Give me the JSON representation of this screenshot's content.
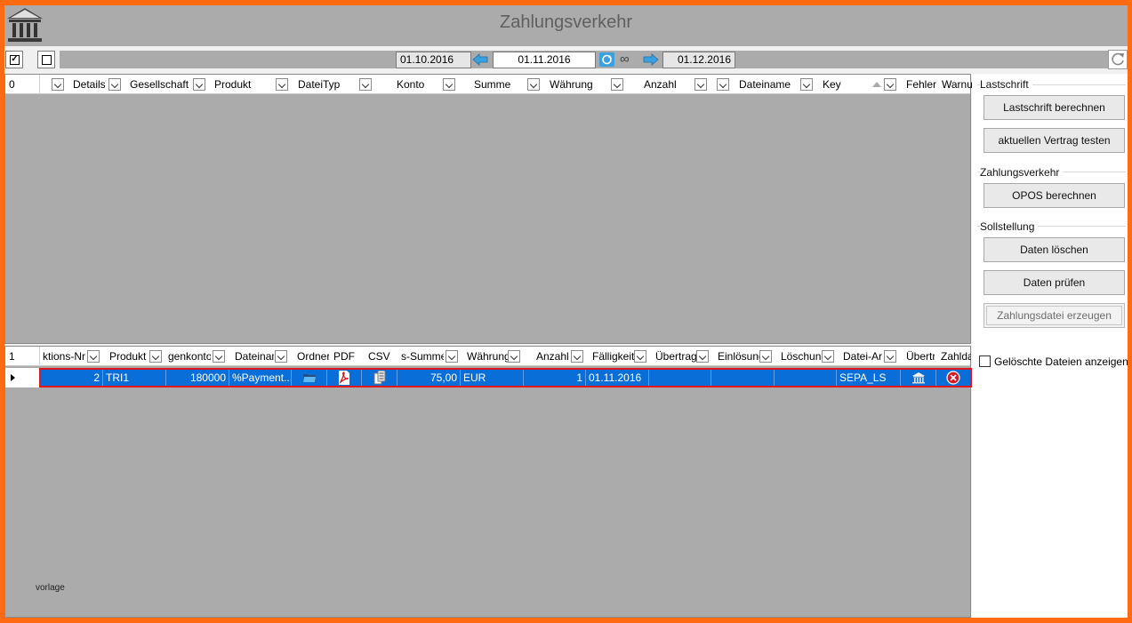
{
  "window": {
    "title": "Zahlungsverkehr"
  },
  "toolbar": {
    "select_all_checked": true,
    "select_none_checked": false,
    "date_prev": "01.10.2016",
    "date_current": "01.11.2016",
    "date_next": "01.12.2016",
    "link_symbol": "∞"
  },
  "grid_top": {
    "count": "0",
    "columns": [
      "Details",
      "Gesellschaft",
      "Produkt",
      "DateiTyp",
      "Konto",
      "Summe",
      "Währung",
      "Anzahl",
      "Dateiname",
      "Key",
      "Fehler",
      "Warnu"
    ]
  },
  "grid_bottom": {
    "count": "1",
    "columns": [
      "ktions-Nr",
      "Produkt",
      "genkonto",
      "Dateinam",
      "Ordner",
      "PDF",
      "CSV",
      "s-Summe",
      "Währung",
      "Anzahl",
      "Fälligkeit",
      "Übertragu",
      "Einlösung",
      "Löschung",
      "Datei-Art",
      "Übertr",
      "Zahlda"
    ],
    "row": {
      "nr": "2",
      "produkt": "TRI1",
      "konto": "180000",
      "dateiname": "%Payment...",
      "summe": "75,00",
      "waehrung": "EUR",
      "anzahl": "1",
      "faelligkeit": "01.11.2016",
      "uebertragung": "",
      "einloesung": "",
      "loeschung": "",
      "datei_art": "SEPA_LS"
    },
    "footnote": "vorlage"
  },
  "panel": {
    "lastschrift": {
      "label": "Lastschrift",
      "btn_berechnen": "Lastschrift berechnen",
      "btn_testen": "aktuellen Vertrag testen"
    },
    "zahlungsverkehr": {
      "label": "Zahlungsverkehr",
      "btn_opos": "OPOS berechnen"
    },
    "sollstellung": {
      "label": "Sollstellung",
      "btn_loeschen": "Daten löschen",
      "btn_pruefen": "Daten prüfen",
      "btn_erzeugen": "Zahlungsdatei erzeugen"
    },
    "show_deleted": {
      "label": "Gelöschte Dateien anzeigen",
      "checked": false
    }
  },
  "colors": {
    "accent_border": "#ff6a13",
    "selection": "#0a6ed8",
    "selection_outline": "#e0161b",
    "grid_bg": "#ababab"
  }
}
